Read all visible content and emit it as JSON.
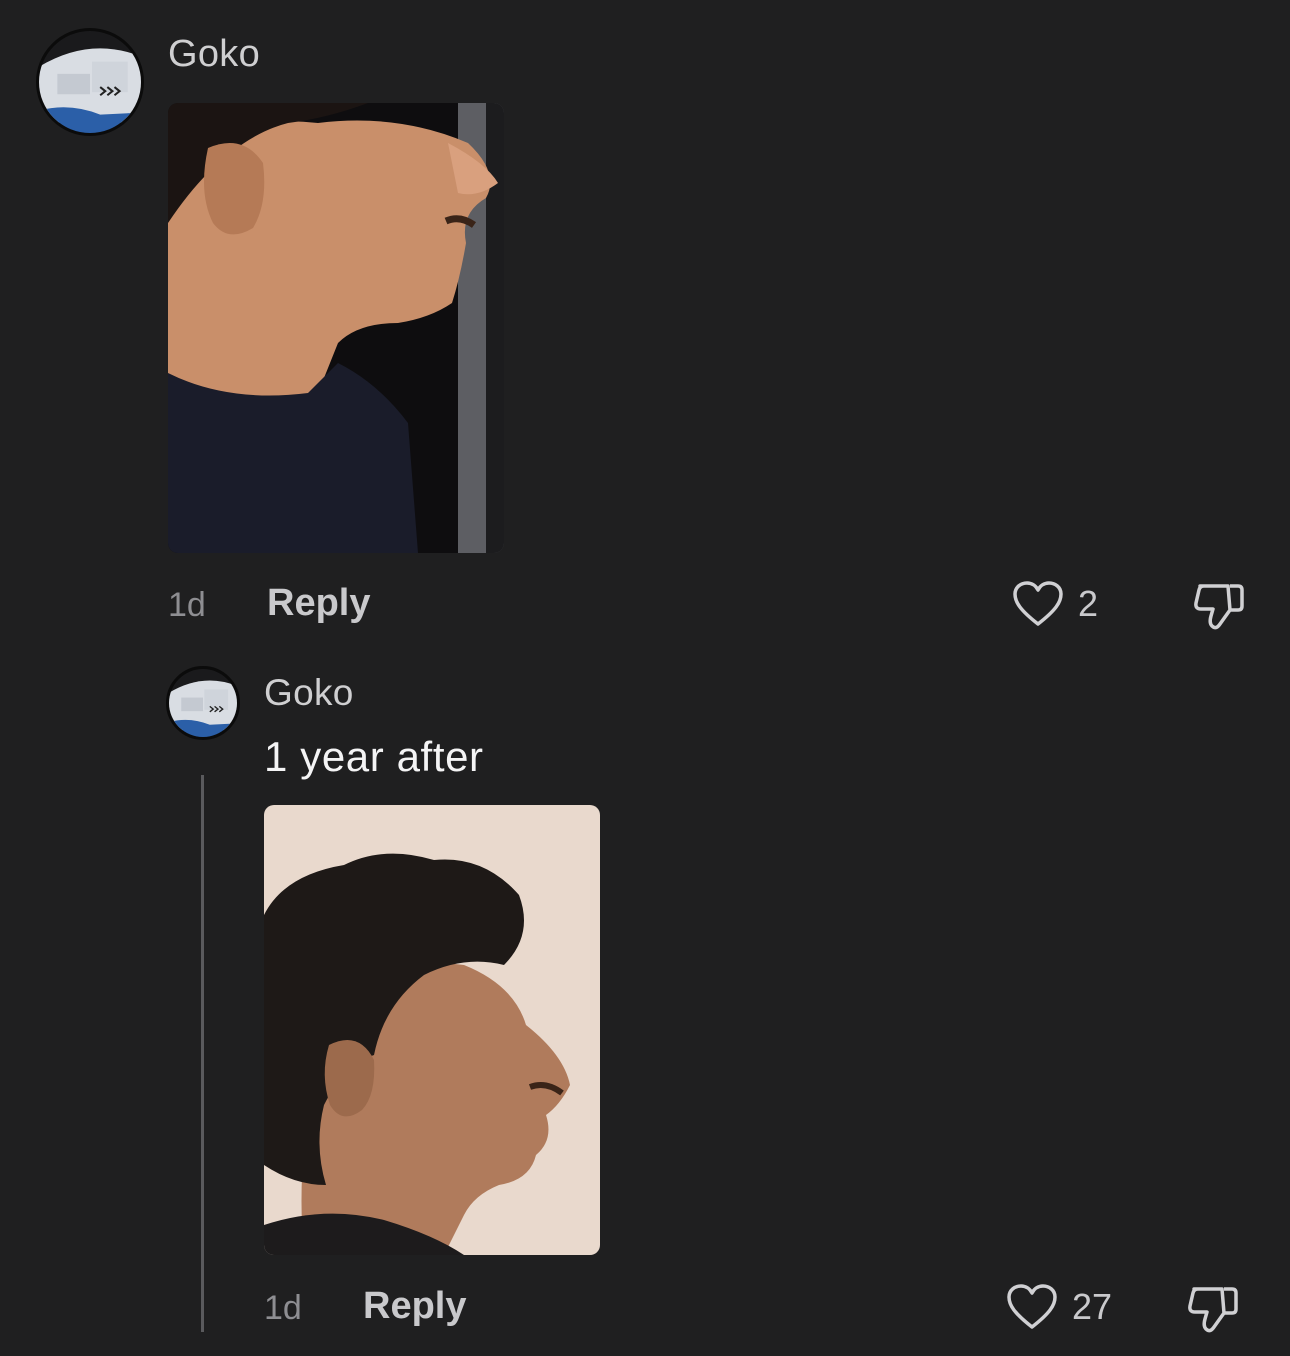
{
  "comments": [
    {
      "username": "Goko",
      "text": "",
      "time": "1d",
      "reply_label": "Reply",
      "likes": "2"
    },
    {
      "username": "Goko",
      "text": "1 year after",
      "time": "1d",
      "reply_label": "Reply",
      "likes": "27"
    }
  ],
  "icons": {
    "like": "heart-outline-icon",
    "dislike": "thumbs-down-outline-icon"
  },
  "colors": {
    "background": "#1f1f20",
    "muted_text": "#8e8e92",
    "action_text": "#c9c9cc"
  }
}
